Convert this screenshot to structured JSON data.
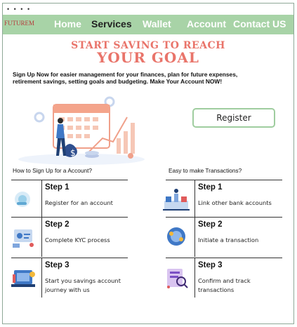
{
  "window": {
    "dots": "• • • •"
  },
  "nav": {
    "logo": "FUTUREM",
    "items": [
      {
        "label": "Home"
      },
      {
        "label": "Services"
      },
      {
        "label": "Wallet"
      },
      {
        "label": "Account"
      },
      {
        "label": "Contact US"
      }
    ],
    "active": "Services"
  },
  "hero": {
    "line1": "START SAVING TO REACH",
    "line2": "YOUR GOAL",
    "intro": "Sign Up Now for easier management for your finances, plan for future expenses, retirement savings, setting goals and budgeting. Make Your Account NOW!"
  },
  "register_label": "Register",
  "signup": {
    "heading": "How to Sign Up for a Account?",
    "steps": [
      {
        "title": "Step 1",
        "desc": "Register for an account"
      },
      {
        "title": "Step 2",
        "desc": "Complete KYC process"
      },
      {
        "title": "Step 3",
        "desc": "Start you savings account journey with us"
      }
    ]
  },
  "transactions": {
    "heading": "Easy to make Transactions?",
    "steps": [
      {
        "title": "Step 1",
        "desc": "Link other bank accounts"
      },
      {
        "title": "Step 2",
        "desc": "Initiate a transaction"
      },
      {
        "title": "Step 3",
        "desc": "Confirm and track transactions"
      }
    ]
  },
  "colors": {
    "nav_bg": "#a8d3a7",
    "accent": "#e9746a",
    "border": "#9fcd9f"
  }
}
